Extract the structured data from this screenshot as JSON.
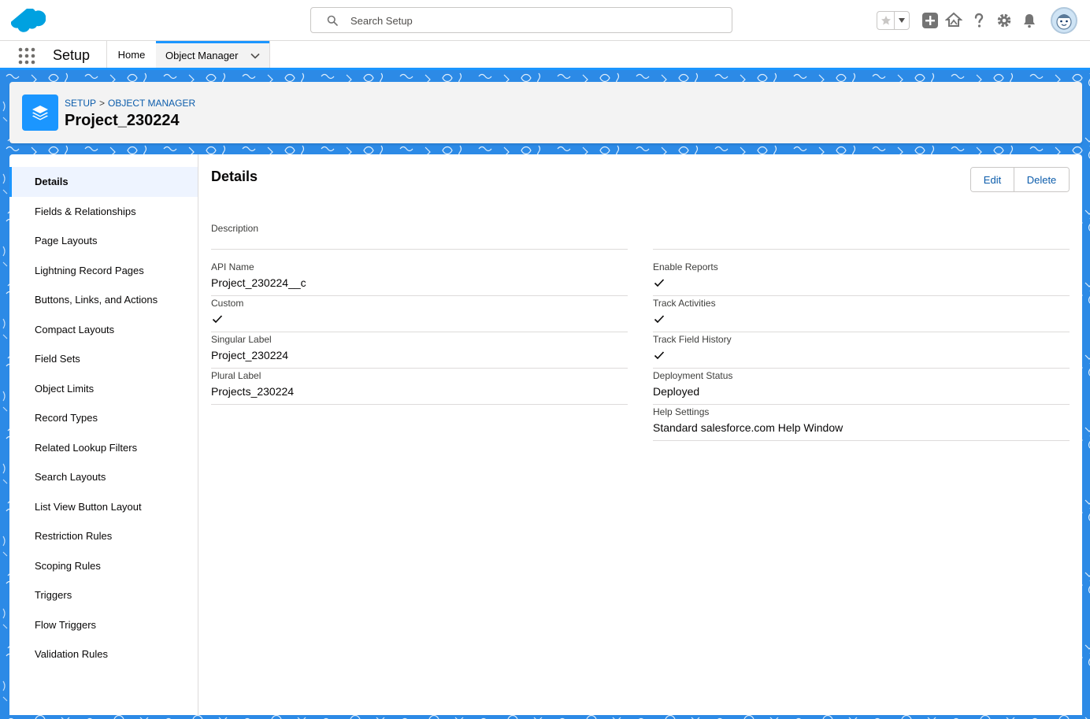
{
  "header": {
    "search_placeholder": "Search Setup"
  },
  "context_bar": {
    "app_name": "Setup",
    "nav_home": "Home",
    "nav_object_manager": "Object Manager"
  },
  "page_header": {
    "breadcrumb_setup": "SETUP",
    "breadcrumb_separator": ">",
    "breadcrumb_object_manager": "OBJECT MANAGER",
    "title": "Project_230224"
  },
  "sidebar": {
    "items": [
      {
        "label": "Details"
      },
      {
        "label": "Fields & Relationships"
      },
      {
        "label": "Page Layouts"
      },
      {
        "label": "Lightning Record Pages"
      },
      {
        "label": "Buttons, Links, and Actions"
      },
      {
        "label": "Compact Layouts"
      },
      {
        "label": "Field Sets"
      },
      {
        "label": "Object Limits"
      },
      {
        "label": "Record Types"
      },
      {
        "label": "Related Lookup Filters"
      },
      {
        "label": "Search Layouts"
      },
      {
        "label": "List View Button Layout"
      },
      {
        "label": "Restriction Rules"
      },
      {
        "label": "Scoping Rules"
      },
      {
        "label": "Triggers"
      },
      {
        "label": "Flow Triggers"
      },
      {
        "label": "Validation Rules"
      }
    ]
  },
  "details": {
    "title": "Details",
    "edit_label": "Edit",
    "delete_label": "Delete",
    "description_label": "Description",
    "left_fields": [
      {
        "label": "API Name",
        "value": "Project_230224__c"
      },
      {
        "label": "Custom",
        "value": ""
      },
      {
        "label": "Singular Label",
        "value": "Project_230224"
      },
      {
        "label": "Plural Label",
        "value": "Projects_230224"
      }
    ],
    "right_fields": [
      {
        "label": "Enable Reports",
        "value": ""
      },
      {
        "label": "Track Activities",
        "value": ""
      },
      {
        "label": "Track Field History",
        "value": ""
      },
      {
        "label": "Deployment Status",
        "value": "Deployed"
      },
      {
        "label": "Help Settings",
        "value": "Standard salesforce.com Help Window"
      }
    ]
  },
  "colors": {
    "brand_blue": "#1b96ff",
    "link_blue": "#0b5cab",
    "pattern_bg": "#2c8ae6"
  }
}
